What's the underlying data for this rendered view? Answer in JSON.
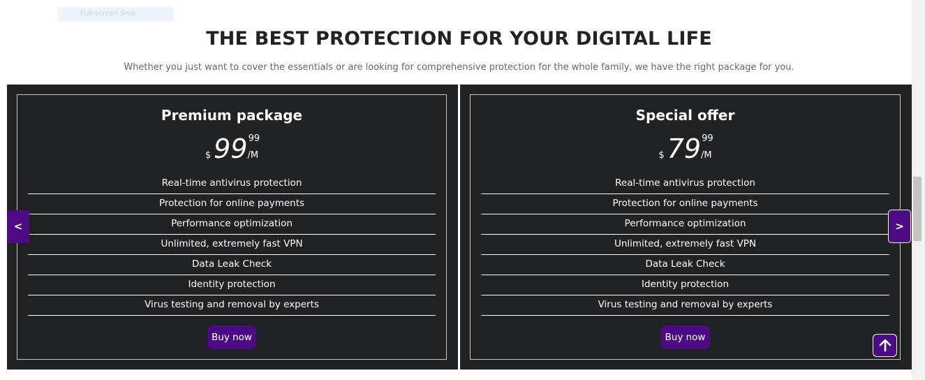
{
  "snip_tag": "Full-screen Snip",
  "header": {
    "title": "THE BEST PROTECTION FOR YOUR DIGITAL LIFE",
    "subtitle": "Whether you just want to cover the essentials or are looking for comprehensive protection for the whole family, we have the right package for you."
  },
  "carousel": {
    "prev_label": "<",
    "next_label": ">",
    "cards": [
      {
        "title": "Premium package",
        "currency": "$",
        "amount": "99",
        "cents": "99",
        "period": "/M",
        "features": [
          "Real-time antivirus protection",
          "Protection for online payments",
          "Performance optimization",
          "Unlimited, extremely fast VPN",
          "Data Leak Check",
          "Identity protection",
          "Virus testing and removal by experts"
        ],
        "button_label": "Buy now"
      },
      {
        "title": "Special offer",
        "currency": "$",
        "amount": "79",
        "cents": "99",
        "period": "/M",
        "features": [
          "Real-time antivirus protection",
          "Protection for online payments",
          "Performance optimization",
          "Unlimited, extremely fast VPN",
          "Data Leak Check",
          "Identity protection",
          "Virus testing and removal by experts"
        ],
        "button_label": "Buy now"
      }
    ]
  },
  "back_to_top_icon": "arrow-up-icon",
  "colors": {
    "accent": "#4b0c83",
    "card_background": "#212223",
    "heading": "#222222",
    "subheading": "#666666"
  }
}
